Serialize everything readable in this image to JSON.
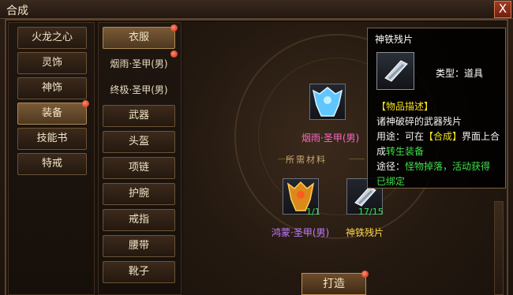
{
  "window": {
    "title": "合成",
    "close_label": "X"
  },
  "left_menu": [
    {
      "label": "火龙之心",
      "active": false,
      "dot": false
    },
    {
      "label": "灵饰",
      "active": false,
      "dot": false
    },
    {
      "label": "神饰",
      "active": false,
      "dot": false
    },
    {
      "label": "装备",
      "active": true,
      "dot": true
    },
    {
      "label": "技能书",
      "active": false,
      "dot": false
    },
    {
      "label": "特戒",
      "active": false,
      "dot": false
    }
  ],
  "mid_menu": [
    {
      "label": "衣服",
      "active": true,
      "dot": true
    },
    {
      "label": "烟雨·圣甲(男)",
      "active": false,
      "dot": true
    },
    {
      "label": "终极·圣甲(男)",
      "active": false,
      "dot": false
    },
    {
      "label": "武器",
      "active": false,
      "dot": false
    },
    {
      "label": "头盔",
      "active": false,
      "dot": false
    },
    {
      "label": "项链",
      "active": false,
      "dot": false
    },
    {
      "label": "护腕",
      "active": false,
      "dot": false
    },
    {
      "label": "戒指",
      "active": false,
      "dot": false
    },
    {
      "label": "腰带",
      "active": false,
      "dot": false
    },
    {
      "label": "靴子",
      "active": false,
      "dot": false
    }
  ],
  "center": {
    "target_name": "烟雨·圣甲(男)",
    "materials_title": "所需材料",
    "material_1_name": "鸿蒙·圣甲(男)",
    "material_1_count": "1/1",
    "material_2_name": "神铁残片",
    "material_2_count": "17/15",
    "craft_label": "打造"
  },
  "tooltip": {
    "title": "神铁残片",
    "type_text": "类型：道具",
    "desc_header": "【物品描述】",
    "desc_1": "诸神破碎的武器残片",
    "usage_prefix": "用途：可在",
    "usage_highlight": "【合成】",
    "usage_suffix": "界面上合",
    "usage_line2_prefix": "成",
    "usage_line2_green": "转生装备",
    "source_prefix": "途径：",
    "source_green": "怪物掉落，活动获得",
    "bound": "已绑定"
  },
  "colors": {
    "accent_green": "#3ee04a",
    "accent_yellow": "#f5e21c",
    "target_name_color": "#ff66c4",
    "material_1_color": "#c07bff",
    "material_2_color": "#ffd84a"
  }
}
